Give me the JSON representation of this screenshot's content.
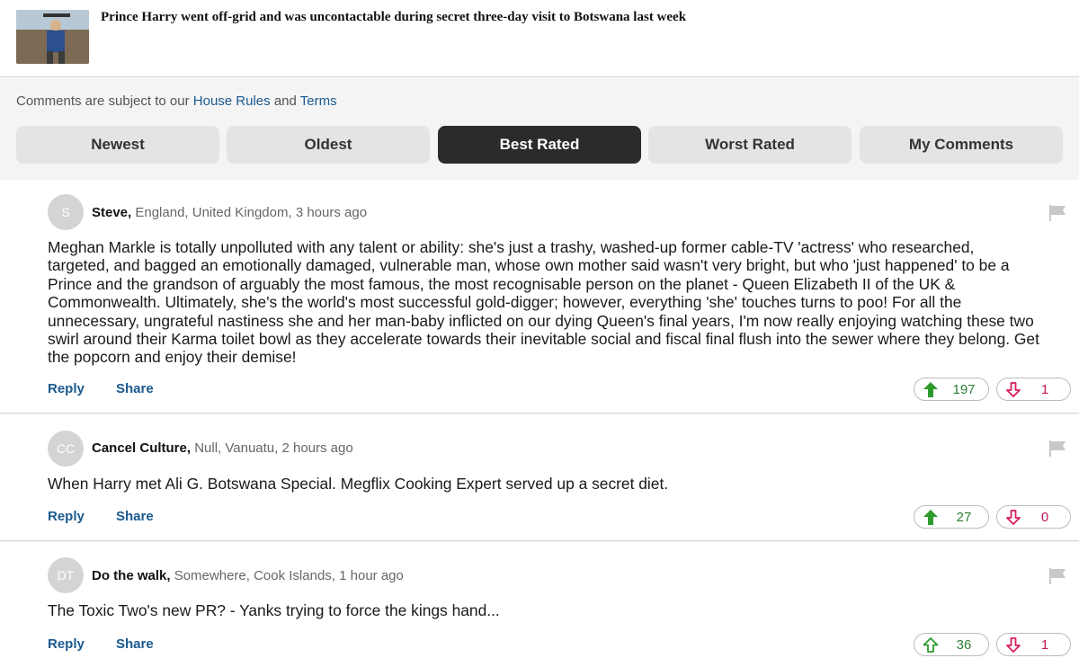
{
  "article": {
    "thumbnail_alt": "Prince Harry photo",
    "title": "Prince Harry went off-grid and was uncontactable during secret three-day visit to Botswana last week"
  },
  "rules": {
    "prefix": "Comments are subject to our ",
    "house_rules": "House Rules",
    "and": " and ",
    "terms": "Terms"
  },
  "tabs": [
    {
      "label": "Newest",
      "active": false
    },
    {
      "label": "Oldest",
      "active": false
    },
    {
      "label": "Best Rated",
      "active": true
    },
    {
      "label": "Worst Rated",
      "active": false
    },
    {
      "label": "My Comments",
      "active": false
    }
  ],
  "comments": [
    {
      "initials": "S",
      "name": "Steve,",
      "location_time": " England, United Kingdom, 3 hours ago",
      "lines": [
        "Meghan Markle is totally unpolluted with any talent or ability: she's just a trashy, washed-up former cable-TV 'actress' who researched,",
        "targeted, and bagged an emotionally damaged, vulnerable man, whose own mother said wasn't very bright, but who 'just happened' to be a",
        "Prince and the grandson of arguably the most famous, the most recognisable person on the planet - Queen Elizabeth II of the UK &",
        "Commonwealth. Ultimately, she's the world's most successful gold-digger; however, everything 'she' touches turns to poo! For all the",
        "unnecessary, ungrateful nastiness she and her man-baby inflicted on our dying Queen's final years, I'm now really enjoying watching these two",
        "swirl around their Karma toilet bowl as they accelerate towards their inevitable social and fiscal final flush into the sewer where they belong. Get",
        "the popcorn and enjoy their demise!"
      ],
      "reply": "Reply",
      "share": "Share",
      "upvotes": "197",
      "downvotes": "1",
      "up_filled": true
    },
    {
      "initials": "CC",
      "name": "Cancel Culture,",
      "location_time": " Null, Vanuatu, 2 hours ago",
      "lines": [
        "When Harry met Ali G. Botswana Special. Megflix Cooking Expert served up a secret diet."
      ],
      "reply": "Reply",
      "share": "Share",
      "upvotes": "27",
      "downvotes": "0",
      "up_filled": true
    },
    {
      "initials": "DT",
      "name": "Do the walk,",
      "location_time": " Somewhere, Cook Islands, 1 hour ago",
      "lines": [
        "The Toxic Two's new PR? - Yanks trying to force the kings hand..."
      ],
      "reply": "Reply",
      "share": "Share",
      "upvotes": "36",
      "downvotes": "1",
      "up_filled": false
    }
  ],
  "colors": {
    "link": "#1b5a8f",
    "active_tab": "#2b2b2b",
    "upvote": "#2e7d32",
    "downvote": "#c2185b",
    "flag": "#c8c8c8"
  },
  "icons": {
    "upvote": "arrow-up-icon",
    "downvote": "arrow-down-icon",
    "flag": "flag-icon"
  }
}
